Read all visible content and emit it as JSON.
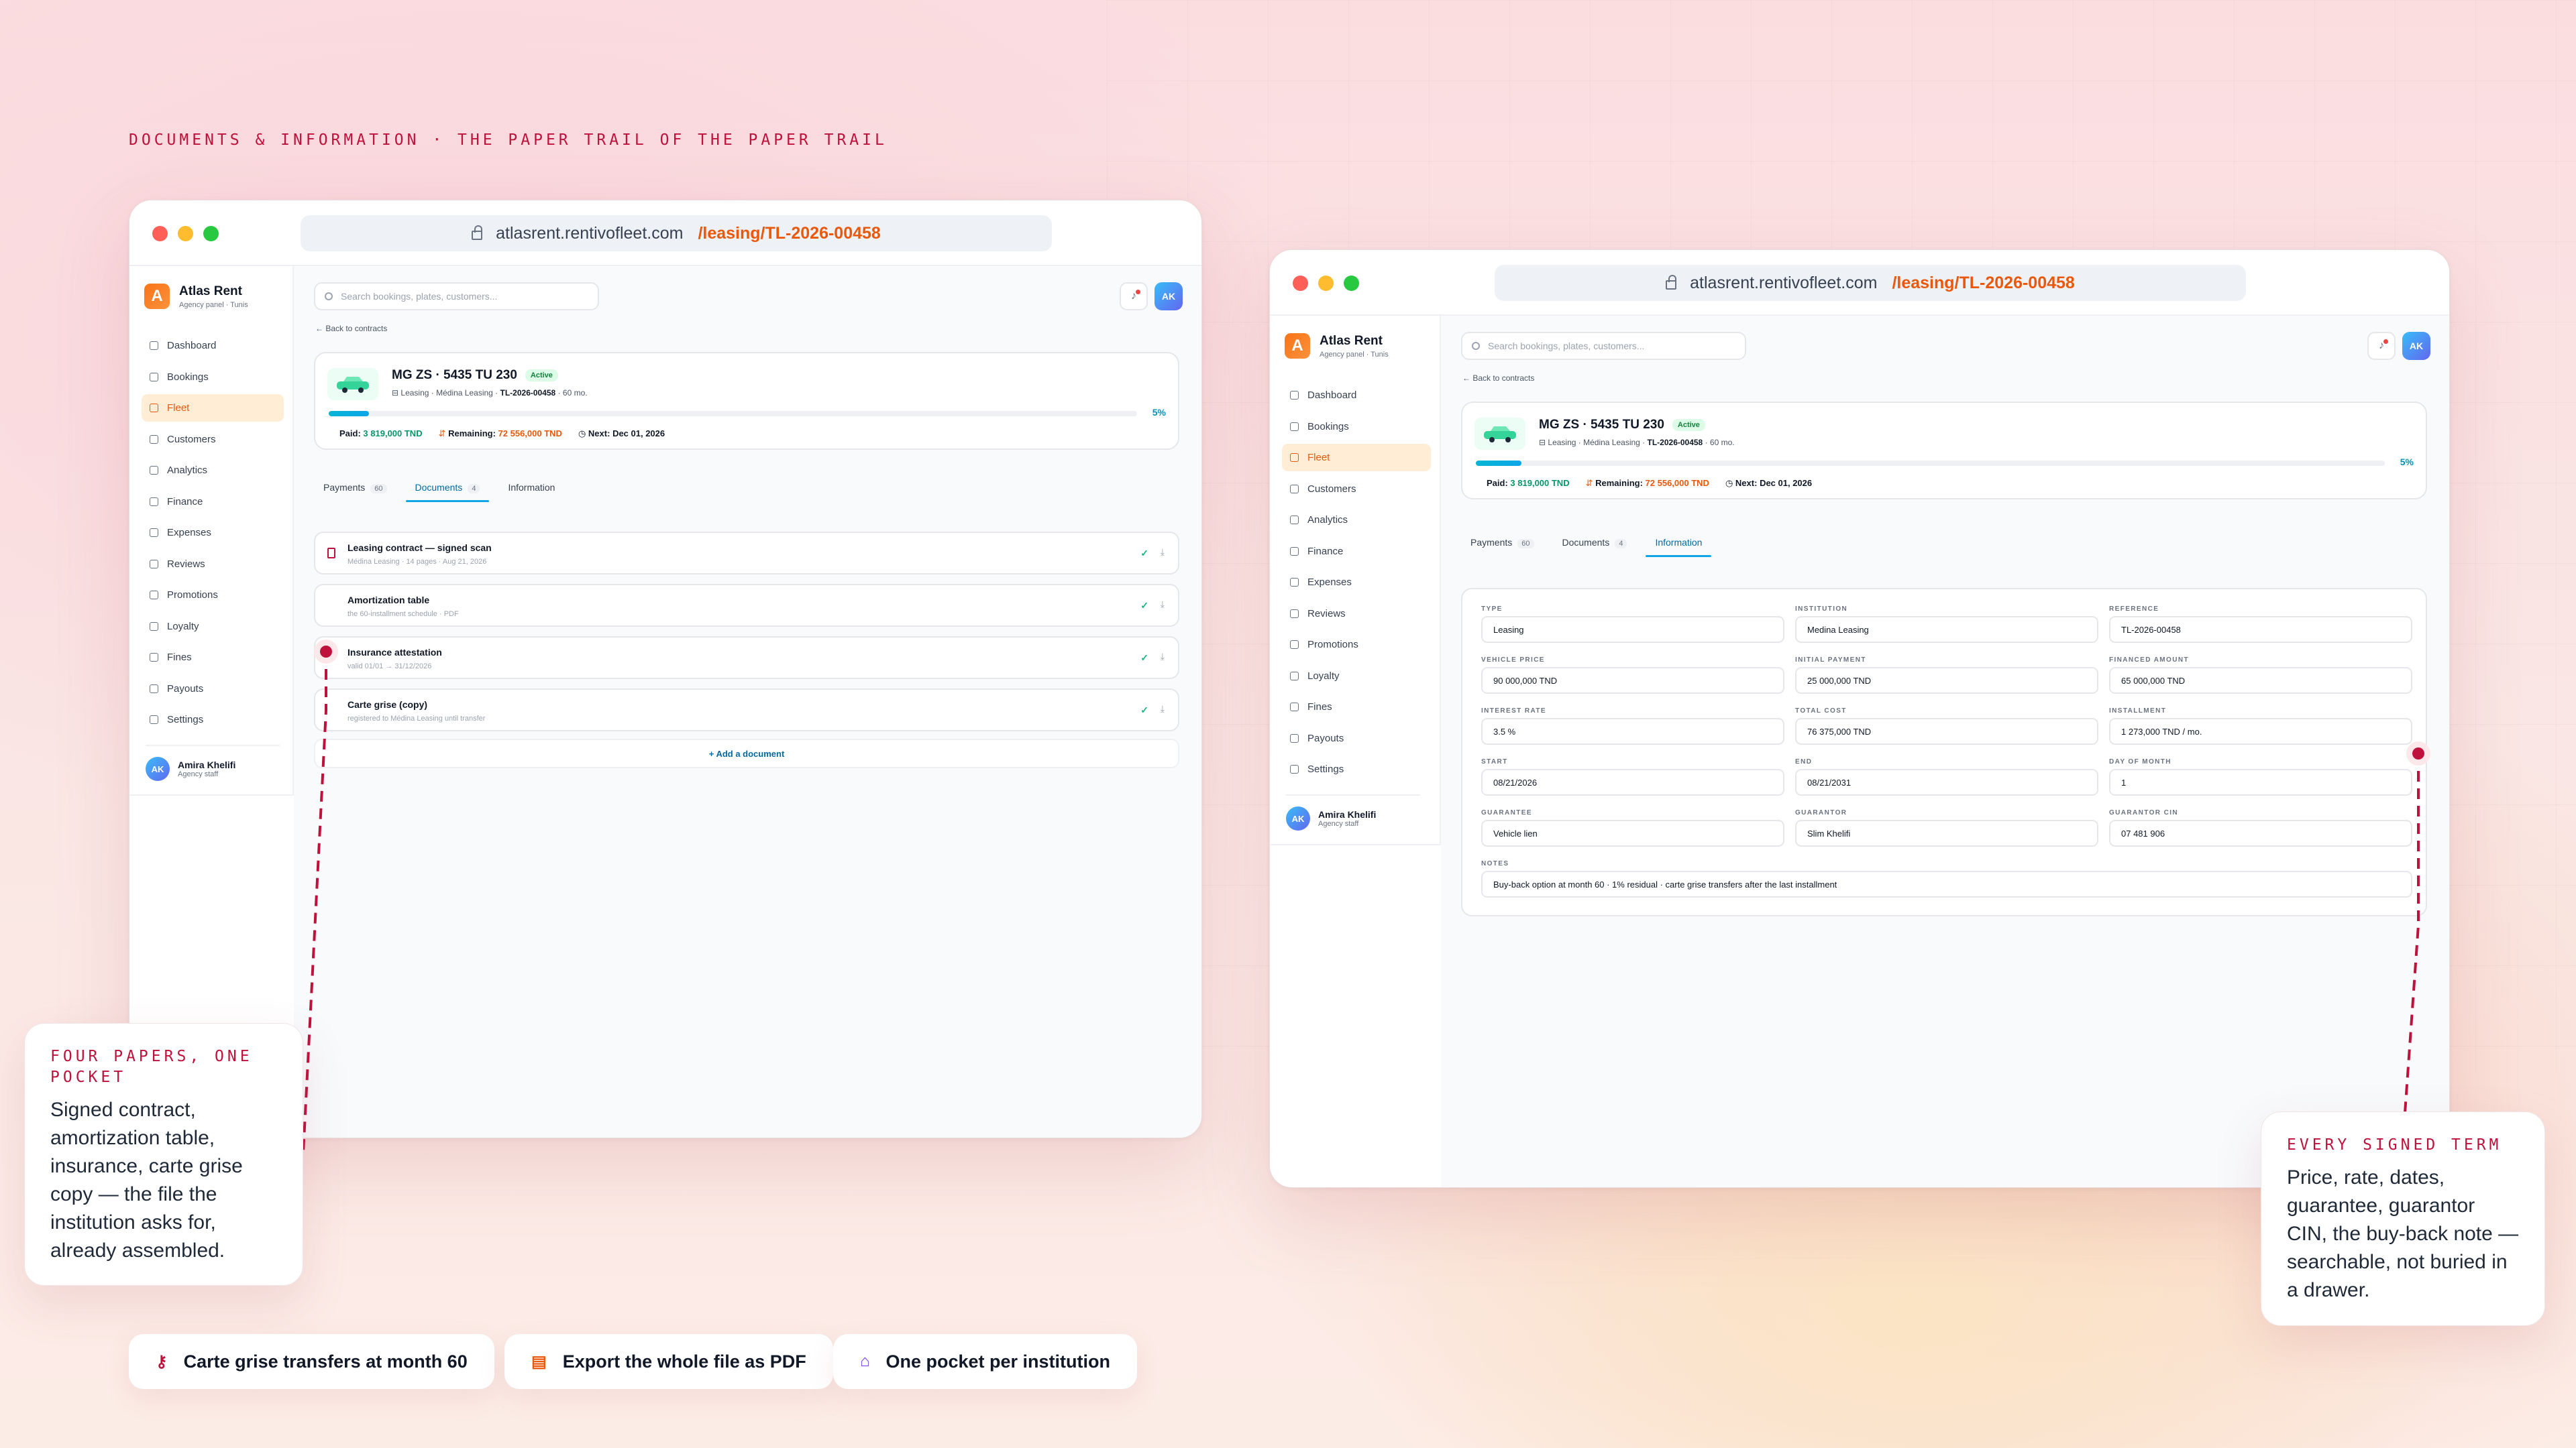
{
  "kicker": "DOCUMENTS & INFORMATION · THE PAPER TRAIL OF THE PAPER TRAIL",
  "window": {
    "url_host": "atlasrent.rentivofleet.com",
    "url_path": "/leasing/TL-2026-00458"
  },
  "brand": {
    "name": "Atlas Rent",
    "subtitle": "Agency panel · Tunis",
    "logo_letter": "A"
  },
  "sidebar": {
    "items": [
      {
        "label": "Dashboard",
        "icon": "grid-icon"
      },
      {
        "label": "Bookings",
        "icon": "calendar-icon"
      },
      {
        "label": "Fleet",
        "icon": "car-icon",
        "active": true
      },
      {
        "label": "Customers",
        "icon": "users-icon"
      },
      {
        "label": "Analytics",
        "icon": "chart-icon"
      },
      {
        "label": "Finance",
        "icon": "wallet-icon"
      },
      {
        "label": "Expenses",
        "icon": "receipt-icon"
      },
      {
        "label": "Reviews",
        "icon": "star-icon"
      },
      {
        "label": "Promotions",
        "icon": "tag-icon"
      },
      {
        "label": "Loyalty",
        "icon": "award-icon"
      },
      {
        "label": "Fines",
        "icon": "shield-icon"
      },
      {
        "label": "Payouts",
        "icon": "bank-icon"
      },
      {
        "label": "Settings",
        "icon": "gear-icon"
      }
    ]
  },
  "user": {
    "initials": "AK",
    "name": "Amira Khelifi",
    "role": "Agency staff"
  },
  "search": {
    "placeholder": "Search bookings, plates, customers..."
  },
  "back_label": "← Back to contracts",
  "contract": {
    "plate": "MG ZS · 5435 TU 230",
    "status": "Active",
    "type": "Leasing",
    "institution": "Médina Leasing",
    "ref": "TL-2026-00458",
    "term": "60 mo.",
    "progress_pct": 5,
    "progress_label": "5%",
    "paid_label": "Paid:",
    "paid": "3 819,000 TND",
    "remaining_label": "Remaining:",
    "remaining": "72 556,000 TND",
    "next_label": "Next:",
    "next": "Dec 01, 2026"
  },
  "tabs": [
    {
      "label": "Payments",
      "count": "60"
    },
    {
      "label": "Documents",
      "count": "4"
    },
    {
      "label": "Information",
      "count": ""
    }
  ],
  "documents": [
    {
      "title": "Leasing contract — signed scan",
      "sub": "Médina Leasing · 14 pages · Aug 21, 2026"
    },
    {
      "title": "Amortization table",
      "sub": "the 60-installment schedule · PDF"
    },
    {
      "title": "Insurance attestation",
      "sub": "valid 01/01 → 31/12/2026"
    },
    {
      "title": "Carte grise (copy)",
      "sub": "registered to Médina Leasing until transfer"
    }
  ],
  "add_document": "+ Add a document",
  "information": {
    "fields": [
      {
        "label": "TYPE",
        "value": "Leasing"
      },
      {
        "label": "INSTITUTION",
        "value": "Medina Leasing"
      },
      {
        "label": "REFERENCE",
        "value": "TL-2026-00458"
      },
      {
        "label": "VEHICLE PRICE",
        "value": "90 000,000 TND"
      },
      {
        "label": "INITIAL PAYMENT",
        "value": "25 000,000 TND"
      },
      {
        "label": "FINANCED AMOUNT",
        "value": "65 000,000 TND"
      },
      {
        "label": "INTEREST RATE",
        "value": "3.5 %"
      },
      {
        "label": "TOTAL COST",
        "value": "76 375,000 TND"
      },
      {
        "label": "INSTALLMENT",
        "value": "1 273,000 TND / mo."
      },
      {
        "label": "START",
        "value": "08/21/2026"
      },
      {
        "label": "END",
        "value": "08/21/2031"
      },
      {
        "label": "DAY OF MONTH",
        "value": "1"
      },
      {
        "label": "GUARANTEE",
        "value": "Vehicle lien"
      },
      {
        "label": "GUARANTOR",
        "value": "Slim Khelifi"
      },
      {
        "label": "GUARANTOR CIN",
        "value": "07 481 906"
      }
    ],
    "notes_label": "NOTES",
    "notes": "Buy-back option at month 60 · 1% residual · carte grise transfers after the last installment"
  },
  "callouts": {
    "left": {
      "title": "FOUR PAPERS, ONE POCKET",
      "body": "Signed contract, amortization table, insurance, carte grise copy — the file the institution asks for, already assembled."
    },
    "right": {
      "title": "EVERY SIGNED TERM",
      "body": "Price, rate, dates, guarantee, guarantor CIN, the buy-back note — searchable, not buried in a drawer."
    }
  },
  "pills": [
    {
      "label": "Carte grise transfers at month 60",
      "icon": "key-icon"
    },
    {
      "label": "Export the whole file as PDF",
      "icon": "document-icon"
    },
    {
      "label": "One pocket per institution",
      "icon": "bank-icon"
    }
  ],
  "colors": {
    "accent": "#ea580c",
    "brand_red": "#be123c",
    "teal": "#0ea5e9"
  }
}
